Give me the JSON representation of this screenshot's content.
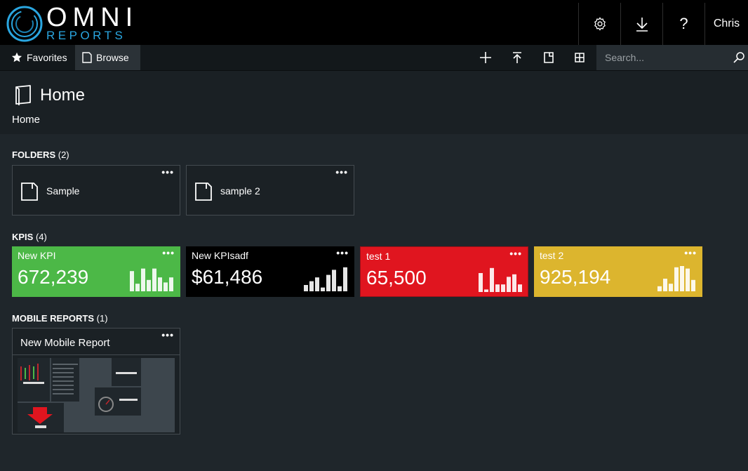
{
  "header": {
    "logo_primary": "OMNI",
    "logo_secondary": "REPORTS",
    "user_name": "Chris",
    "buttons": [
      {
        "name": "settings",
        "icon": "gear-icon"
      },
      {
        "name": "download",
        "icon": "download-icon"
      },
      {
        "name": "help",
        "icon": "help-icon",
        "glyph": "?"
      }
    ]
  },
  "nav": {
    "tabs": [
      {
        "label": "Favorites",
        "icon": "star-icon",
        "active": false
      },
      {
        "label": "Browse",
        "icon": "browse-icon",
        "active": true
      }
    ],
    "tools": [
      "add-icon",
      "upload-icon",
      "view-list-icon",
      "tile-view-icon"
    ],
    "search_placeholder": "Search..."
  },
  "page": {
    "title": "Home",
    "breadcrumb": "Home"
  },
  "folders": {
    "heading": "FOLDERS",
    "count": "(2)",
    "items": [
      {
        "name": "Sample"
      },
      {
        "name": "sample 2"
      }
    ]
  },
  "kpis": {
    "heading": "KPIS",
    "count": "(4)",
    "items": [
      {
        "name": "New KPI",
        "value": "672,239",
        "color": "#4cb847",
        "bars": [
          0.8,
          0.3,
          0.9,
          0.45,
          0.9,
          0.55,
          0.35,
          0.55
        ]
      },
      {
        "name": "New KPIsadf",
        "value": "$61,486",
        "color": "#000000",
        "bars": [
          0.25,
          0.4,
          0.55,
          0.15,
          0.65,
          0.85,
          0.2,
          0.95
        ]
      },
      {
        "name": "test 1",
        "value": "65,500",
        "color": "#e0151f",
        "bars": [
          0.75,
          0.1,
          0.95,
          0.3,
          0.3,
          0.6,
          0.7,
          0.3
        ]
      },
      {
        "name": "test 2",
        "value": "925,194",
        "color": "#dcb52e",
        "bars": [
          0.2,
          0.5,
          0.3,
          0.95,
          1.0,
          0.9,
          0.45
        ]
      }
    ]
  },
  "mobile_reports": {
    "heading": "MOBILE REPORTS",
    "count": "(1)",
    "items": [
      {
        "name": "New Mobile Report"
      }
    ]
  },
  "colors": {
    "accent": "#2aa6e0",
    "background": "#1f262b",
    "topbar": "#000000"
  }
}
